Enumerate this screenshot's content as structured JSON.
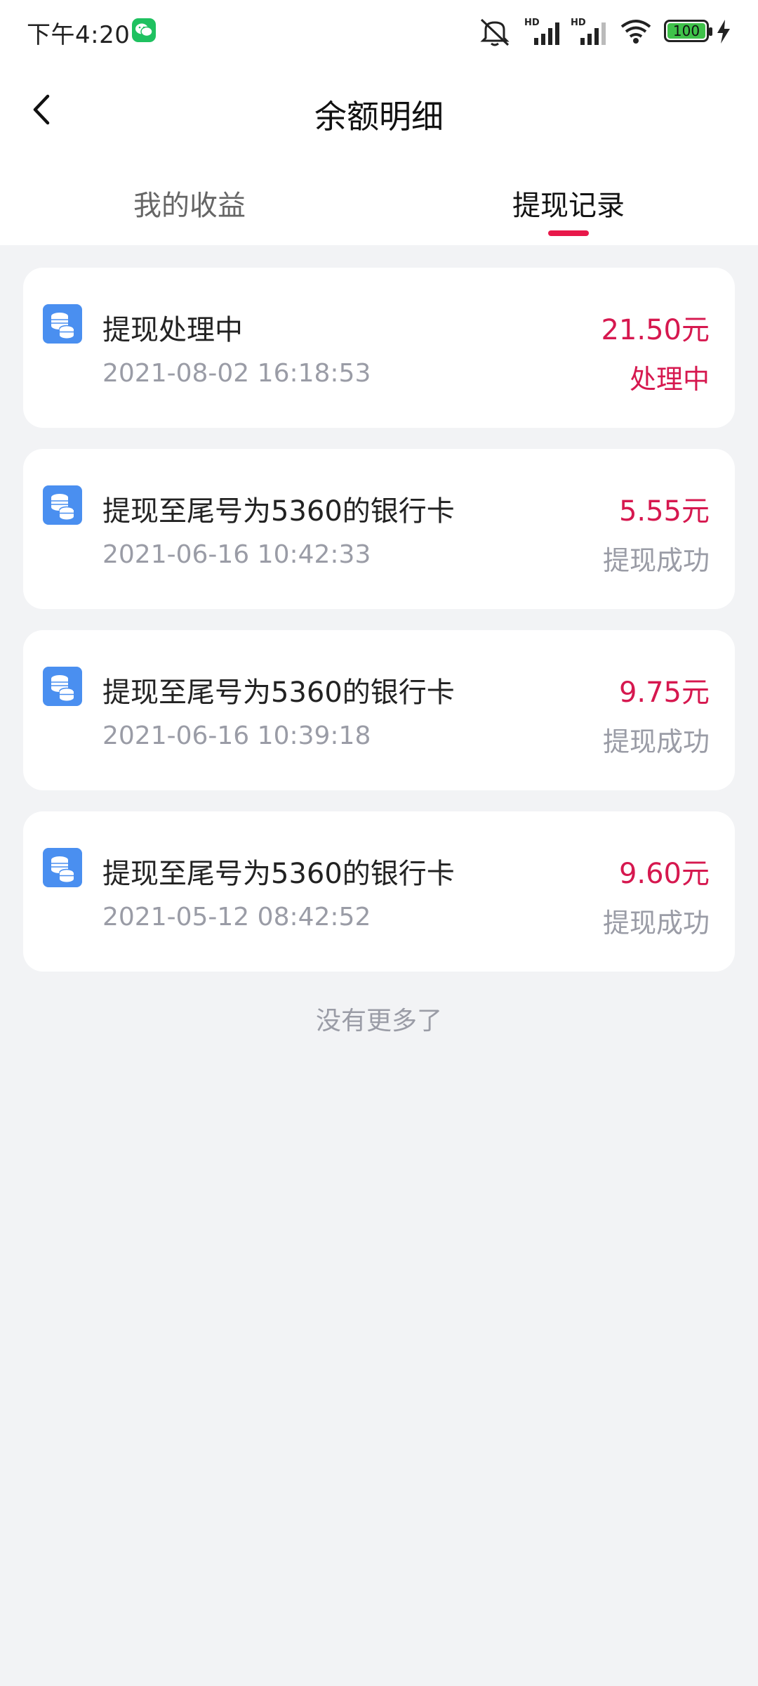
{
  "status_bar": {
    "time": "下午4:20",
    "battery": "100"
  },
  "nav": {
    "title": "余额明细"
  },
  "tabs": [
    {
      "label": "我的收益",
      "active": false
    },
    {
      "label": "提现记录",
      "active": true
    }
  ],
  "records": [
    {
      "title": "提现处理中",
      "date": "2021-08-02 16:18:53",
      "amount": "21.50元",
      "status": "处理中",
      "status_type": "processing"
    },
    {
      "title": "提现至尾号为5360的银行卡",
      "date": "2021-06-16 10:42:33",
      "amount": "5.55元",
      "status": "提现成功",
      "status_type": "success"
    },
    {
      "title": "提现至尾号为5360的银行卡",
      "date": "2021-06-16 10:39:18",
      "amount": "9.75元",
      "status": "提现成功",
      "status_type": "success"
    },
    {
      "title": "提现至尾号为5360的银行卡",
      "date": "2021-05-12 08:42:52",
      "amount": "9.60元",
      "status": "提现成功",
      "status_type": "success"
    }
  ],
  "footer": {
    "no_more_text": "没有更多了"
  },
  "colors": {
    "accent": "#e8184a",
    "amount": "#d6184f",
    "muted": "#9a9ca6",
    "icon_blue": "#4a8ff0",
    "background": "#f2f3f5"
  },
  "icons": {
    "record_icon": "coins-icon",
    "back_icon": "chevron-left-icon"
  }
}
